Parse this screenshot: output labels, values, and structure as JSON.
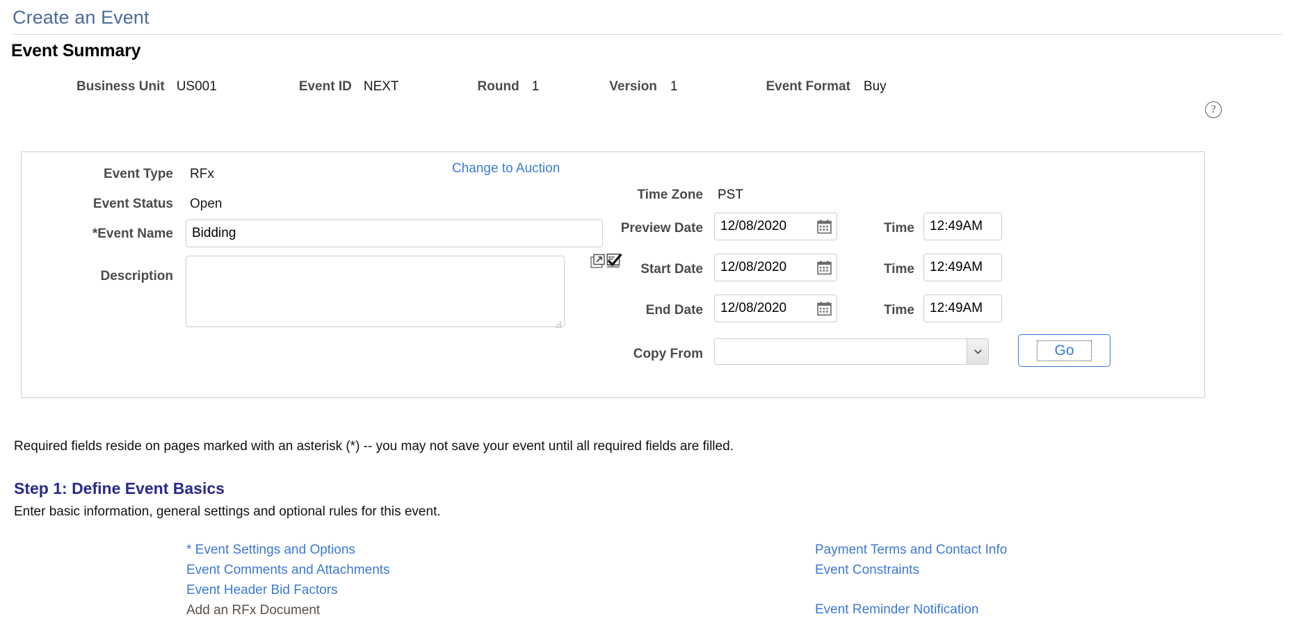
{
  "page": {
    "title": "Create an Event",
    "section_title": "Event Summary"
  },
  "summary": {
    "fields": [
      {
        "label": "Business Unit",
        "value": "US001"
      },
      {
        "label": "Event ID",
        "value": "NEXT"
      },
      {
        "label": "Round",
        "value": "1"
      },
      {
        "label": "Version",
        "value": "1"
      },
      {
        "label": "Event Format",
        "value": "Buy"
      }
    ]
  },
  "help": {
    "glyph": "?"
  },
  "panel": {
    "event_type_label": "Event Type",
    "event_type_value": "RFx",
    "event_status_label": "Event Status",
    "event_status_value": "Open",
    "event_name_label": "*Event Name",
    "event_name_value": "Bidding",
    "event_name_placeholder": "",
    "description_label": "Description",
    "description_value": "",
    "description_placeholder": "",
    "change_to_auction_link": "Change to Auction",
    "time_zone_label": "Time Zone",
    "time_zone_value": "PST",
    "preview_date_label": "Preview Date",
    "preview_date_value": "12/08/2020",
    "preview_time_label": "Time",
    "preview_time_value": "12:49AM",
    "start_date_label": "Start Date",
    "start_date_value": "12/08/2020",
    "start_time_label": "Time",
    "start_time_value": "12:49AM",
    "end_date_label": "End Date",
    "end_date_value": "12/08/2020",
    "end_time_label": "Time",
    "end_time_value": "12:49AM",
    "copy_from_label": "Copy From",
    "copy_from_value": "",
    "go_button_label": "Go"
  },
  "note": "Required fields reside on pages marked with an asterisk (*) -- you may not save your event until all required fields are filled.",
  "step": {
    "title": "Step 1: Define Event Basics",
    "description": "Enter basic information, general settings and optional rules for this event."
  },
  "links": {
    "left": [
      {
        "label": "* Event Settings and Options",
        "enabled": true
      },
      {
        "label": "Event Comments and Attachments",
        "enabled": true
      },
      {
        "label": "Event Header Bid Factors",
        "enabled": true
      },
      {
        "label": "Add an RFx Document",
        "enabled": false
      }
    ],
    "right": [
      {
        "label": "Payment Terms and Contact Info",
        "enabled": true
      },
      {
        "label": "Event Constraints",
        "enabled": true
      },
      {
        "label": "Event Reminder Notification",
        "enabled": true
      }
    ]
  },
  "colors": {
    "title_blue": "#4b6a99",
    "link_blue": "#3b79d4",
    "step_blue": "#2a2a8c",
    "label_gray": "#4b4b4b",
    "panel_border": "#d0d0d0"
  }
}
